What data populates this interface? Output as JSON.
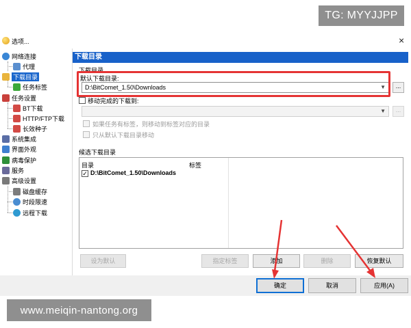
{
  "watermarks": {
    "top_right": "TG: MYYJJPP",
    "bottom_left": "www.meiqin-nantong.org"
  },
  "dialog": {
    "title": "选项...",
    "close": "×"
  },
  "tree": {
    "items": [
      {
        "label": "网络连接",
        "icon": "network-icon",
        "icon_color": "#3a87d6"
      },
      {
        "label": "代理",
        "icon": "proxy-icon",
        "icon_color": "#5a8fcf"
      },
      {
        "label": "下载目录",
        "icon": "folder-icon",
        "icon_color": "#e9b43d"
      },
      {
        "label": "任务标签",
        "icon": "tag-icon",
        "icon_color": "#3ca83a"
      },
      {
        "label": "任务设置",
        "icon": "task-settings-icon",
        "icon_color": "#c9413c"
      },
      {
        "label": "BT下载",
        "icon": "bt-download-icon",
        "icon_color": "#d24a45"
      },
      {
        "label": "HTTP/FTP下载",
        "icon": "http-ftp-icon",
        "icon_color": "#d24a45"
      },
      {
        "label": "长效种子",
        "icon": "long-seed-icon",
        "icon_color": "#d24a45"
      },
      {
        "label": "系统集成",
        "icon": "system-integration-icon",
        "icon_color": "#5a6ea6"
      },
      {
        "label": "界面外观",
        "icon": "appearance-icon",
        "icon_color": "#3f7fcf"
      },
      {
        "label": "病毒保护",
        "icon": "virus-shield-icon",
        "icon_color": "#2f8f3a"
      },
      {
        "label": "服务",
        "icon": "service-icon",
        "icon_color": "#6a6a9a"
      },
      {
        "label": "高级设置",
        "icon": "advanced-settings-icon",
        "icon_color": "#7a7a7a"
      },
      {
        "label": "磁盘缓存",
        "icon": "disk-cache-icon",
        "icon_color": "#7c7c7c"
      },
      {
        "label": "时段限速",
        "icon": "clock-icon",
        "icon_color": "#4a8dd1"
      },
      {
        "label": "远程下载",
        "icon": "remote-download-icon",
        "icon_color": "#2f9ad1"
      }
    ]
  },
  "panel": {
    "header": "下载目录",
    "group_label": "下载目录",
    "default_dir_label": "默认下载目录:",
    "default_dir_value": "D:\\BitComet_1.50\\Downloads",
    "browse": "...",
    "move_label": "移动完成的下载到:",
    "move_value": "",
    "opt_tag": "如果任务有标签，则移动到标签对应的目录",
    "opt_default_only": "只从默认下载目录移动",
    "candidate_label": "候选下载目录",
    "list_headers": [
      "目录",
      "标签"
    ],
    "list_rows": [
      {
        "checked": "✓",
        "dir": "D:\\BitComet_1.50\\Downloads",
        "tag": ""
      }
    ],
    "buttons": {
      "set_default": "设为默认",
      "assign_tag": "指定标签",
      "add": "添加",
      "delete": "删除",
      "restore_default": "恢复默认"
    }
  },
  "footer": {
    "ok": "确定",
    "cancel": "取消",
    "apply": "应用(A)"
  }
}
